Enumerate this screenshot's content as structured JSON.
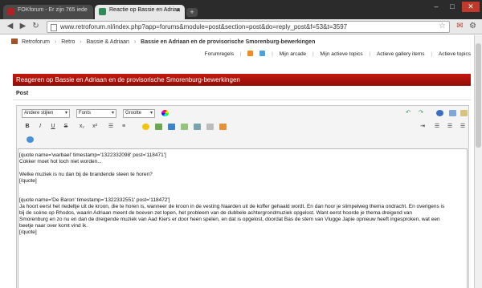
{
  "browser": {
    "tabs": [
      {
        "title": "FOKforum - Er zijn 765 iede",
        "favicon_color": "#b22222"
      },
      {
        "title": "Reactie op Bassie en Adriaa",
        "favicon_color": "#2e8b57"
      }
    ],
    "new_tab": "+",
    "window_controls": {
      "minimize": "–",
      "maximize": "□",
      "close": "✕"
    },
    "url": "www.retroforum.nl/index.php?app=forums&module=post&section=post&do=reply_post&f=53&t=3597"
  },
  "breadcrumb": [
    "Retroforum",
    "Retro",
    "Bassie & Adriaan",
    "Bassie en Adriaan en de provisorische Smorenburg-bewerkingen"
  ],
  "userlinks": [
    "Forumregels",
    "Mijn arcade",
    "Mijn actieve topics",
    "Actieve gallery items",
    "Actieve topics"
  ],
  "section_title": "Reageren op Bassie en Adriaan en de provisorische Smorenburg-bewerkingen",
  "post_label": "Post",
  "editor": {
    "style_select": "Andere stijlen",
    "font_select": "Fonts",
    "size_select": "Grootte",
    "buttons": {
      "bold": "B",
      "italic": "I",
      "underline": "U",
      "strike": "S",
      "sub": "x₂",
      "sup": "x²"
    },
    "text_lines": [
      "[quote name='warbael' timestamp='1322332098' post='118471']",
      "Cokker moet hot toch niet worden...",
      "",
      "Welke muziek is nu dan bij de brandende steen te horen?",
      "[/quote]",
      "",
      "",
      "[quote name='De Baron' timestamp='1322332551' post='118472']",
      "Ja hoort eerst het riedeltje uit de kroon, die te horen is, wanneer de kroon in de vesting Naarden uit de koffer gehaald wordt. En dan hoor je slimpelweg thema ondracht. En overigens is",
      "bij de scène op Rhodos, waarin Adriaan meent de boeven zet lopen, het probleem van de dubbele achtergrondmuziek opgelost. Want eerst hoorde je thema dreigend van",
      "Smorenburg en zo nu en dan de dreigende muziek van Aad Kiers er door heen spelen, en dat is opgelost, doordat Bas de stem van Vlugge Japie opnieuw heeft ingesproken, wat een",
      "beetje naar over komt vind ik.",
      "[/quote]"
    ]
  }
}
